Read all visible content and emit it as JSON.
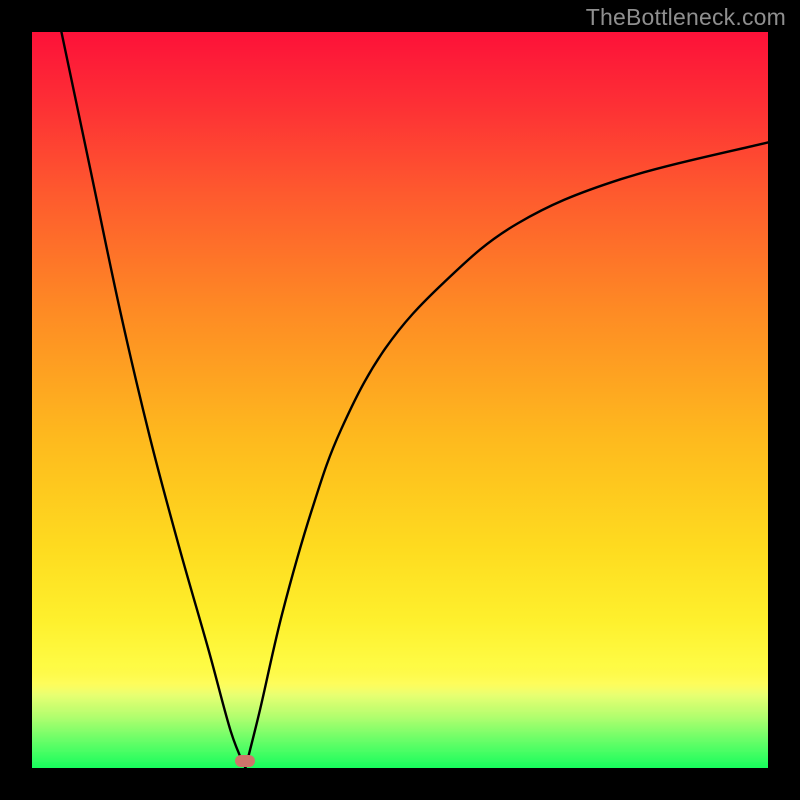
{
  "watermark": "TheBottleneck.com",
  "colors": {
    "frame": "#000000",
    "gradient_top": "#fd1139",
    "gradient_mid": "#fee425",
    "gradient_bottom": "#17fd5d",
    "curve": "#000000",
    "marker": "#cf746b",
    "watermark_text": "#8f8f8f"
  },
  "chart_data": {
    "type": "line",
    "title": "",
    "xlabel": "",
    "ylabel": "",
    "xlim": [
      0,
      100
    ],
    "ylim": [
      0,
      100
    ],
    "grid": false,
    "legend": false,
    "marker": {
      "x": 29,
      "y": 1
    },
    "note": "V-shaped bottleneck curve. x is a normalized component-balance axis; y is bottleneck percentage. Minimum (0%) at x≈29. Left branch rises steeply to 100% near x=0; right branch rises asymptotically toward ~85% at x=100.",
    "series": [
      {
        "name": "left_branch",
        "x": [
          4,
          8,
          12,
          16,
          20,
          24,
          27,
          29
        ],
        "y": [
          100,
          81,
          62,
          45,
          30,
          16,
          5,
          0
        ]
      },
      {
        "name": "right_branch",
        "x": [
          29,
          31,
          34,
          38,
          42,
          48,
          56,
          66,
          80,
          100
        ],
        "y": [
          0,
          8,
          21,
          35,
          46,
          57,
          66,
          74,
          80,
          85
        ]
      }
    ]
  }
}
